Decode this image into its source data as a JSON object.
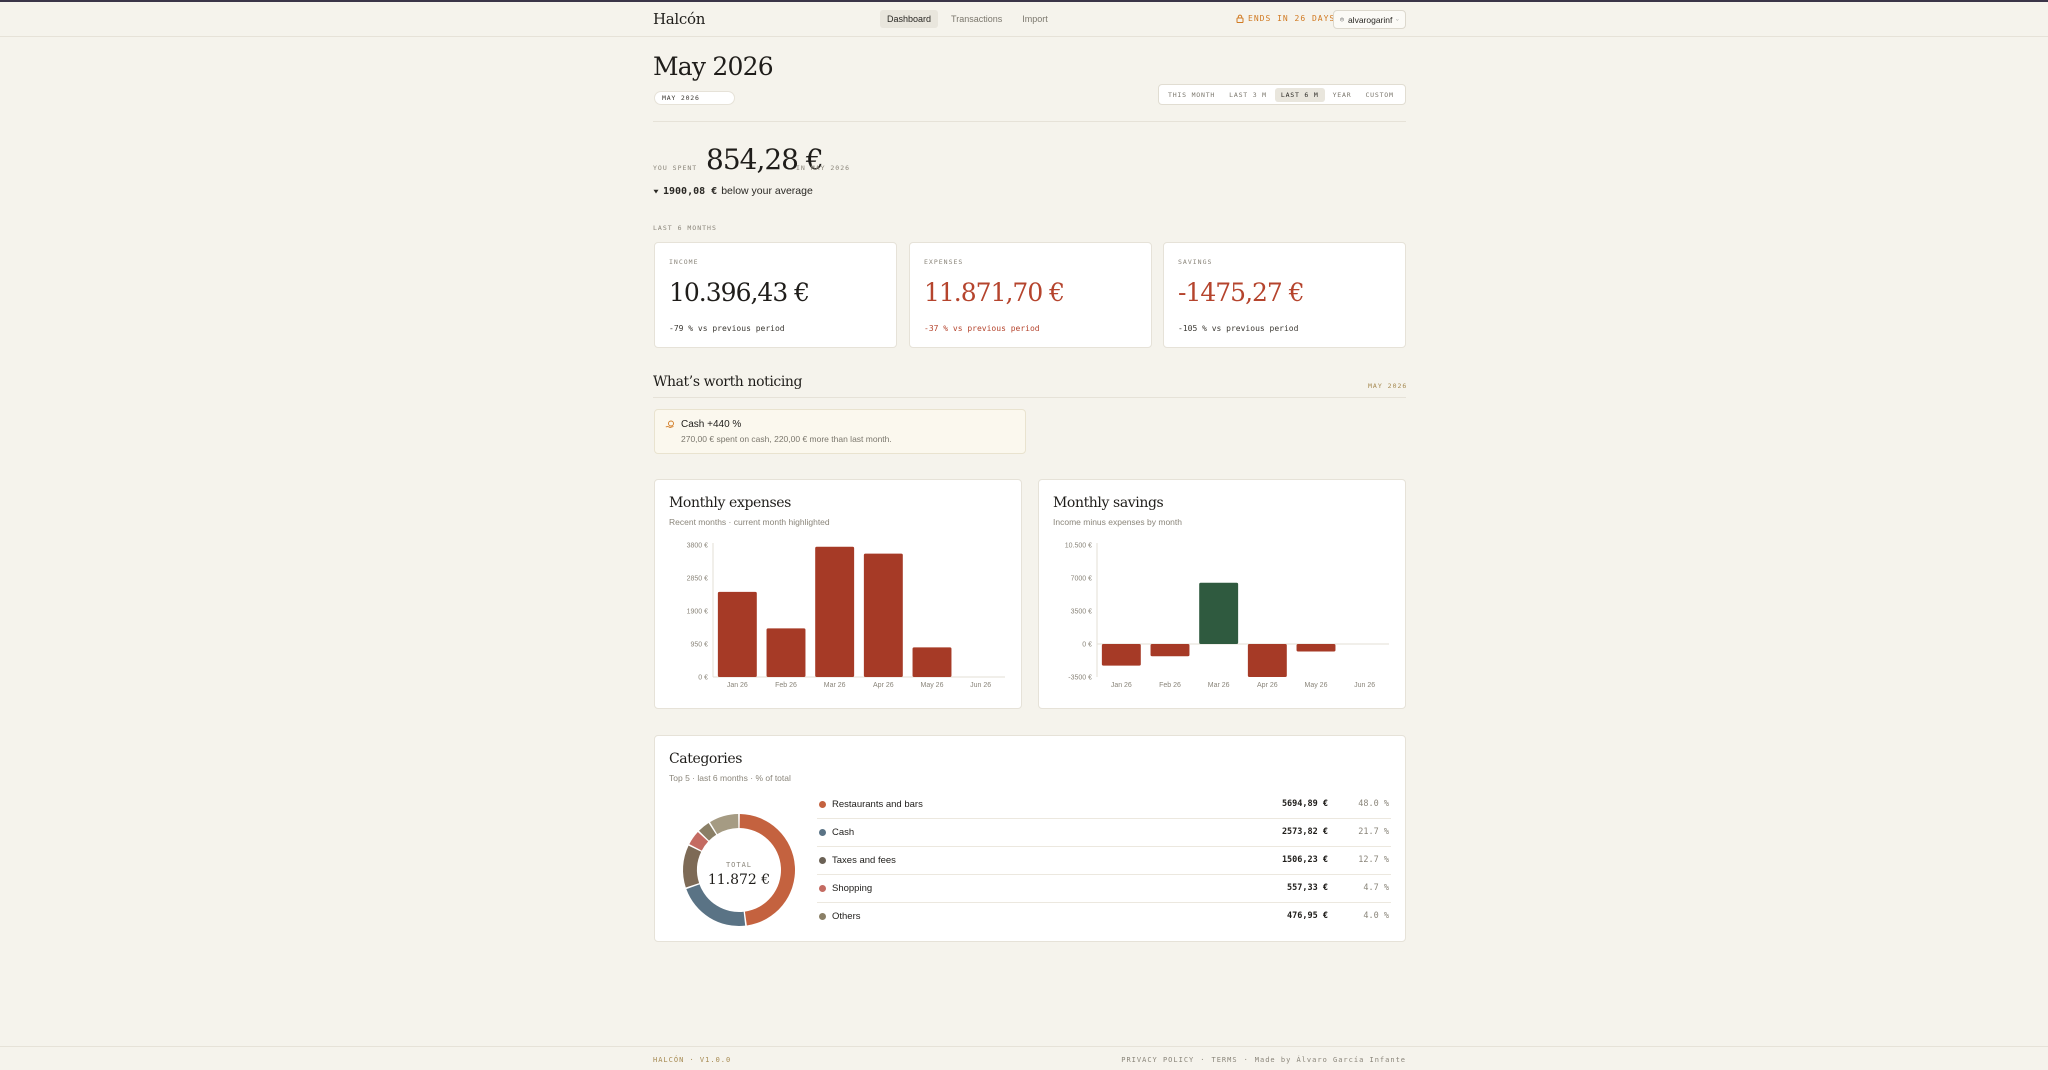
{
  "app": {
    "logo": "Halcón"
  },
  "nav": {
    "items": [
      "Dashboard",
      "Transactions",
      "Import"
    ]
  },
  "header": {
    "trial_text": "ENDS IN 26 DAYS",
    "username": "alvarogarinf"
  },
  "page": {
    "title": "May 2026",
    "period_chip": "MAY 2026"
  },
  "range_tabs": [
    "THIS MONTH",
    "LAST 3 M",
    "LAST 6 M",
    "YEAR",
    "CUSTOM"
  ],
  "summary": {
    "spent_label": "YOU SPENT",
    "spent_amount": "854,28 €",
    "spent_suffix": "IN MAY 2026",
    "below_amount": "1900,08 €",
    "below_text": "below your average",
    "period_label": "LAST 6 MONTHS"
  },
  "stats": [
    {
      "label": "INCOME",
      "value": "10.396,43 €",
      "change": "-79 % vs previous period"
    },
    {
      "label": "EXPENSES",
      "value": "11.871,70 €",
      "change": "-37 % vs previous period"
    },
    {
      "label": "SAVINGS",
      "value": "-1475,27 €",
      "change": "-105 % vs previous period"
    }
  ],
  "noticing": {
    "title": "What’s worth noticing",
    "date": "MAY 2026",
    "card_title": "Cash +440 %",
    "card_body": "270,00 € spent on cash, 220,00 € more than last month."
  },
  "colors": {
    "accent_red": "#a63a26",
    "positive_green": "#2f5a3f",
    "trial_orange": "#d17a22"
  },
  "chart_data": [
    {
      "type": "bar",
      "title": "Monthly expenses",
      "subtitle": "Recent months · current month highlighted",
      "categories": [
        "Jan 26",
        "Feb 26",
        "Mar 26",
        "Apr 26",
        "May 26",
        "Jun 26"
      ],
      "values": [
        2450,
        1400,
        3750,
        3550,
        854.28,
        0
      ],
      "yticks": [
        "3800 €",
        "2850 €",
        "1900 €",
        "950 €",
        "0 €"
      ],
      "ylim": [
        0,
        3800
      ],
      "grid": false
    },
    {
      "type": "bar",
      "title": "Monthly savings",
      "subtitle": "Income minus expenses by month",
      "categories": [
        "Jan 26",
        "Feb 26",
        "Mar 26",
        "Apr 26",
        "May 26",
        "Jun 26"
      ],
      "values": [
        -2300,
        -1300,
        6500,
        -3500,
        -800,
        0
      ],
      "yticks": [
        "10.500 €",
        "7000 €",
        "3500 €",
        "0 €",
        "-3500 €"
      ],
      "ylim": [
        -3500,
        10500
      ],
      "grid": false
    },
    {
      "type": "pie",
      "title": "Categories",
      "subtitle": "Top 5 · last 6 months · % of total",
      "center_label": "TOTAL",
      "center_value": "11.872 €",
      "categories": [
        "Restaurants and bars",
        "Cash",
        "Taxes and fees",
        "Shopping",
        "Others"
      ],
      "amounts": [
        "5694,89 €",
        "2573,82 €",
        "1506,23 €",
        "557,33 €",
        "476,95 €"
      ],
      "percents_label": [
        "48.0 %",
        "21.7 %",
        "12.7 %",
        "4.7 %",
        "4.0 %"
      ],
      "values": [
        48.0,
        21.7,
        12.7,
        4.7,
        4.0,
        8.9
      ],
      "colors": [
        "#c4623f",
        "#5a7385",
        "#7d6a56",
        "#c46b62",
        "#8a7f66",
        "#a59b83"
      ]
    }
  ],
  "footer": {
    "version": "HALCÓN · V1.0.0",
    "privacy": "PRIVACY POLICY",
    "terms": "TERMS",
    "credit": "Made by Álvaro García Infante"
  }
}
